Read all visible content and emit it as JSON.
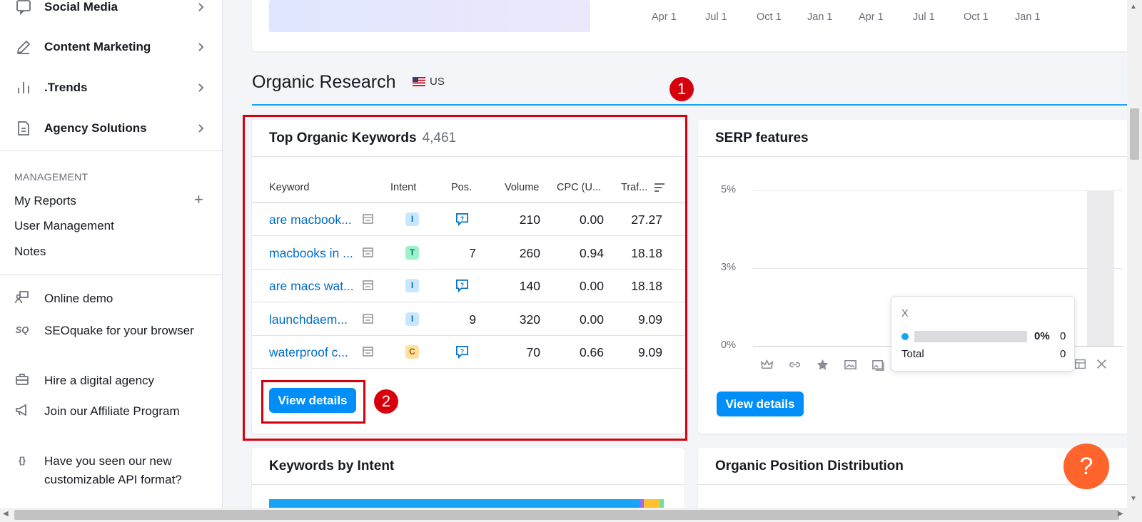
{
  "sidebar": {
    "nav": [
      {
        "label": "Social Media",
        "icon": "chat-bubble-icon"
      },
      {
        "label": "Content Marketing",
        "icon": "pencil-icon"
      },
      {
        "label": ".Trends",
        "icon": "bar-chart-icon"
      },
      {
        "label": "Agency Solutions",
        "icon": "document-icon"
      }
    ],
    "management_label": "MANAGEMENT",
    "management_links": [
      "My Reports",
      "User Management",
      "Notes"
    ],
    "extras": [
      {
        "label": "Online demo",
        "icon": "presenter-icon"
      },
      {
        "label": "SEOquake for your browser",
        "icon": "seoquake-icon",
        "icon_text": "SQ"
      },
      {
        "label": "Hire a digital agency",
        "icon": "briefcase-icon"
      },
      {
        "label": "Join our Affiliate Program",
        "icon": "megaphone-icon"
      },
      {
        "label": "Have you seen our new customizable API format?",
        "icon": "braces-icon",
        "icon_text": "{}"
      }
    ]
  },
  "timeline": {
    "ticks": [
      "Apr 1",
      "Jul 1",
      "Oct 1",
      "Jan 1",
      "Apr 1",
      "Jul 1",
      "Oct 1",
      "Jan 1"
    ]
  },
  "section": {
    "title": "Organic Research",
    "country": "US"
  },
  "top_keywords": {
    "title": "Top Organic Keywords",
    "count": "4,461",
    "columns": [
      "Keyword",
      "Intent",
      "Pos.",
      "Volume",
      "CPC (U...",
      "Traf..."
    ],
    "rows": [
      {
        "keyword": "are macbook...",
        "intent": "I",
        "pos": "",
        "volume": "210",
        "cpc": "0.00",
        "traffic": "27.27"
      },
      {
        "keyword": "macbooks in ...",
        "intent": "T",
        "pos": "7",
        "volume": "260",
        "cpc": "0.94",
        "traffic": "18.18"
      },
      {
        "keyword": "are macs wat...",
        "intent": "I",
        "pos": "",
        "volume": "140",
        "cpc": "0.00",
        "traffic": "18.18"
      },
      {
        "keyword": "launchdaem...",
        "intent": "I",
        "pos": "9",
        "volume": "320",
        "cpc": "0.00",
        "traffic": "9.09"
      },
      {
        "keyword": "waterproof c...",
        "intent": "C",
        "pos": "",
        "volume": "70",
        "cpc": "0.66",
        "traffic": "9.09"
      }
    ],
    "button": "View details"
  },
  "serp": {
    "title": "SERP features",
    "y_ticks": [
      "5%",
      "3%",
      "0%"
    ],
    "tooltip": {
      "name": "X",
      "percent": "0%",
      "value": "0",
      "total_label": "Total",
      "total_value": "0"
    },
    "button": "View details"
  },
  "intent_card": {
    "title": "Keywords by Intent"
  },
  "position_card": {
    "title": "Organic Position Distribution"
  },
  "annotations": {
    "badge1": "1",
    "badge2": "2"
  },
  "help": {
    "label": "?"
  },
  "colors": {
    "accent": "#008ff8",
    "link": "#006dca",
    "annotation": "#d6000d",
    "help": "#ff642d"
  }
}
